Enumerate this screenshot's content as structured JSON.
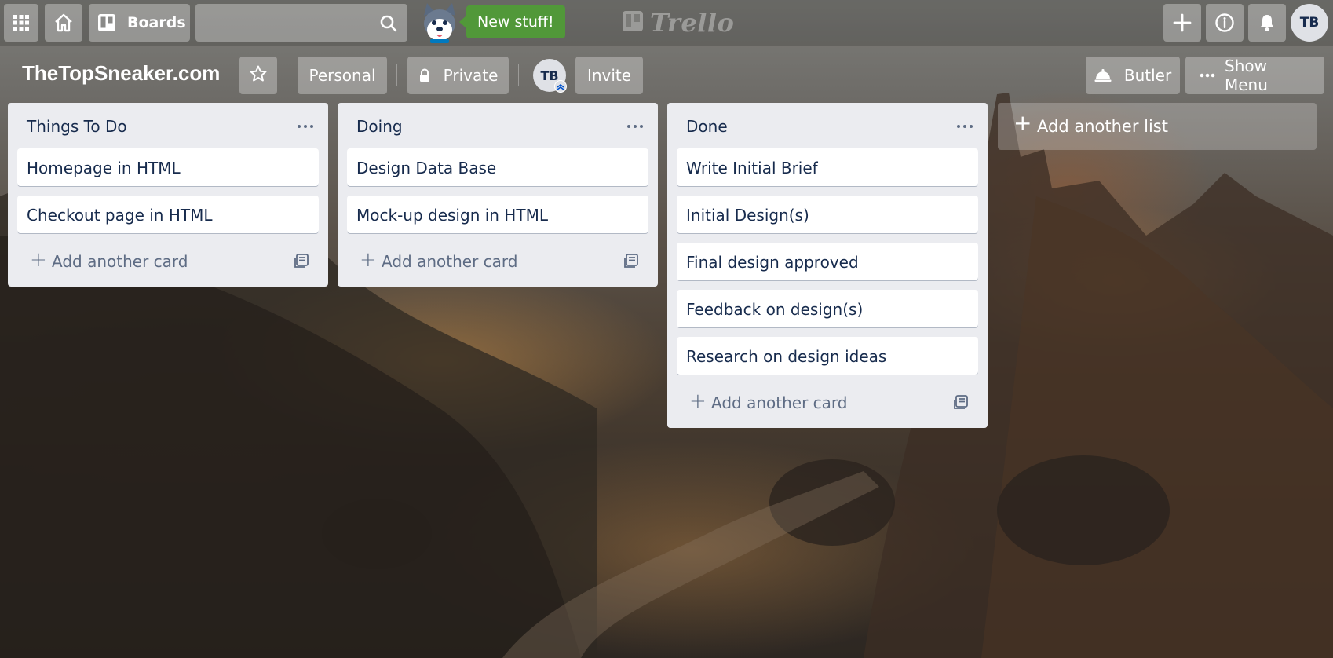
{
  "header": {
    "boards_label": "Boards",
    "new_stuff_label": "New stuff!",
    "logo_text": "Trello",
    "user_initials": "TB"
  },
  "board": {
    "title": "TheTopSneaker.com",
    "team_label": "Personal",
    "visibility_label": "Private",
    "member_initials": "TB",
    "invite_label": "Invite",
    "butler_label": "Butler",
    "show_menu_label": "Show Menu"
  },
  "lists": [
    {
      "title": "Things To Do",
      "cards": [
        "Homepage in HTML",
        "Checkout page in HTML"
      ],
      "add_card_label": "Add another card"
    },
    {
      "title": "Doing",
      "cards": [
        "Design Data Base",
        "Mock-up design in HTML"
      ],
      "add_card_label": "Add another card"
    },
    {
      "title": "Done",
      "cards": [
        "Write Initial Brief",
        "Initial Design(s)",
        "Final design approved",
        "Feedback on design(s)",
        "Research on design ideas"
      ],
      "add_card_label": "Add another card"
    }
  ],
  "add_list_label": "Add another list",
  "colors": {
    "list_bg": "#ebecf0",
    "card_text": "#172b4d",
    "muted_text": "#5e6c84",
    "new_stuff_green": "#519839"
  },
  "icons": [
    "apps-grid-icon",
    "home-icon",
    "boards-icon",
    "search-icon",
    "mascot-icon",
    "trello-logo-icon",
    "plus-icon",
    "info-icon",
    "bell-icon",
    "star-icon",
    "lock-icon",
    "butler-icon",
    "more-icon",
    "card-template-icon"
  ]
}
